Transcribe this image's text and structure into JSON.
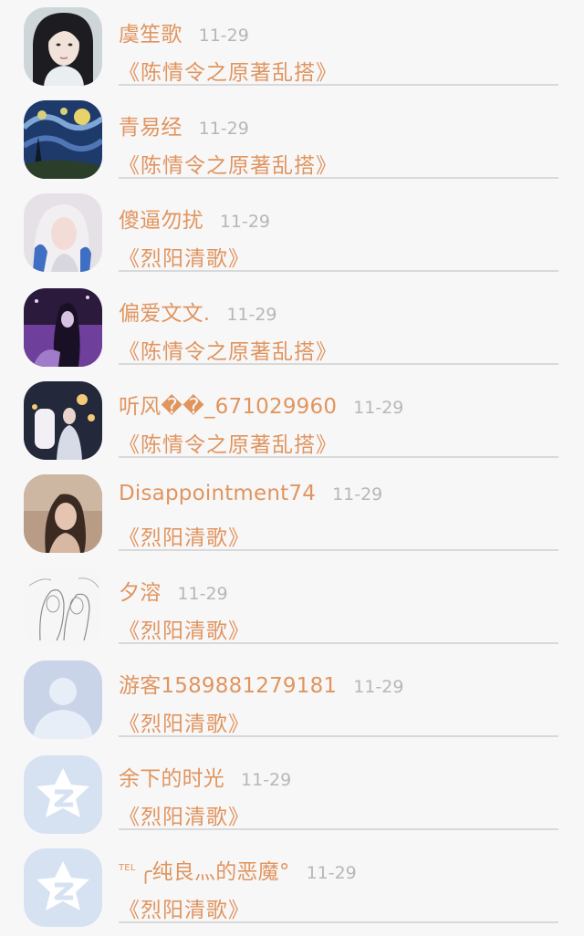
{
  "comments": [
    {
      "name": "虞笙歌",
      "time": "11-29",
      "work": "《陈情令之原著乱搭》",
      "avatar": "portrait-woman"
    },
    {
      "name": "青易经",
      "time": "11-29",
      "work": "《陈情令之原著乱搭》",
      "avatar": "starry-night"
    },
    {
      "name": "傻逼勿扰",
      "time": "11-29",
      "work": "《烈阳清歌》",
      "avatar": "girl-blue-hair"
    },
    {
      "name": "偏爱文文.",
      "time": "11-29",
      "work": "《陈情令之原著乱搭》",
      "avatar": "purple-night"
    },
    {
      "name": "听风��_671029960",
      "time": "11-29",
      "work": "《陈情令之原著乱搭》",
      "avatar": "lantern-night"
    },
    {
      "name": "Disappointment74",
      "time": "11-29",
      "work": "《烈阳清歌》",
      "avatar": "girl-warm"
    },
    {
      "name": "夕溶",
      "time": "11-29",
      "work": "《烈阳清歌》",
      "avatar": "sketch-art"
    },
    {
      "name": "游客1589881279181",
      "time": "11-29",
      "work": "《烈阳清歌》",
      "avatar": "default-user"
    },
    {
      "name": "余下的时光",
      "time": "11-29",
      "work": "《烈阳清歌》",
      "avatar": "qzone-star"
    },
    {
      "tel": "TEL",
      "name": "╭纯良灬的恶魔°",
      "time": "11-29",
      "work": "《烈阳清歌》",
      "avatar": "qzone-star"
    }
  ]
}
